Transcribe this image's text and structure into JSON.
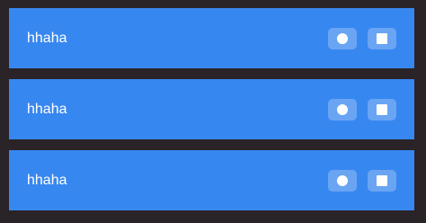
{
  "rows": [
    {
      "label": "hhaha",
      "actions": [
        "record-icon",
        "stop-icon"
      ]
    },
    {
      "label": "hhaha",
      "actions": [
        "record-icon",
        "stop-icon"
      ]
    },
    {
      "label": "hhaha",
      "actions": [
        "record-icon",
        "stop-icon"
      ]
    }
  ],
  "colors": {
    "background": "#2a2327",
    "row": "#3787f0",
    "button": "#6aa5f4",
    "text": "#ffffff"
  }
}
